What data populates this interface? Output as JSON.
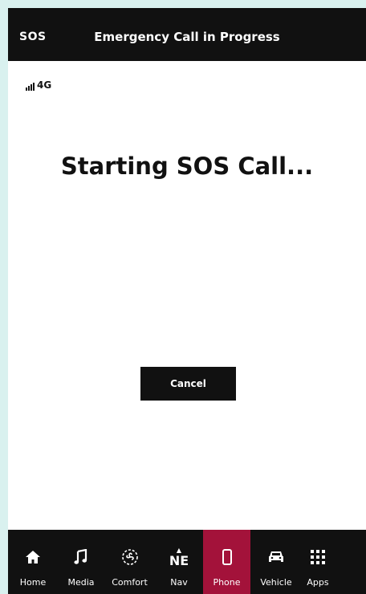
{
  "header": {
    "left_label": "SOS",
    "title": "Emergency Call in Progress"
  },
  "status": {
    "network": "4G"
  },
  "main": {
    "headline": "Starting SOS Call...",
    "cancel_label": "Cancel"
  },
  "nav": {
    "items": [
      {
        "label": "Home",
        "icon": "home-icon"
      },
      {
        "label": "Media",
        "icon": "music-note-icon"
      },
      {
        "label": "Comfort",
        "icon": "fan-icon"
      },
      {
        "label": "Nav",
        "icon": "compass-icon",
        "icon_text": "NE"
      },
      {
        "label": "Phone",
        "icon": "phone-icon",
        "active": true
      },
      {
        "label": "Vehicle",
        "icon": "car-icon"
      },
      {
        "label": "Apps",
        "icon": "grid-icon"
      }
    ]
  },
  "colors": {
    "background": "#d9f1ef",
    "bar": "#111111",
    "accent": "#a3123a"
  }
}
